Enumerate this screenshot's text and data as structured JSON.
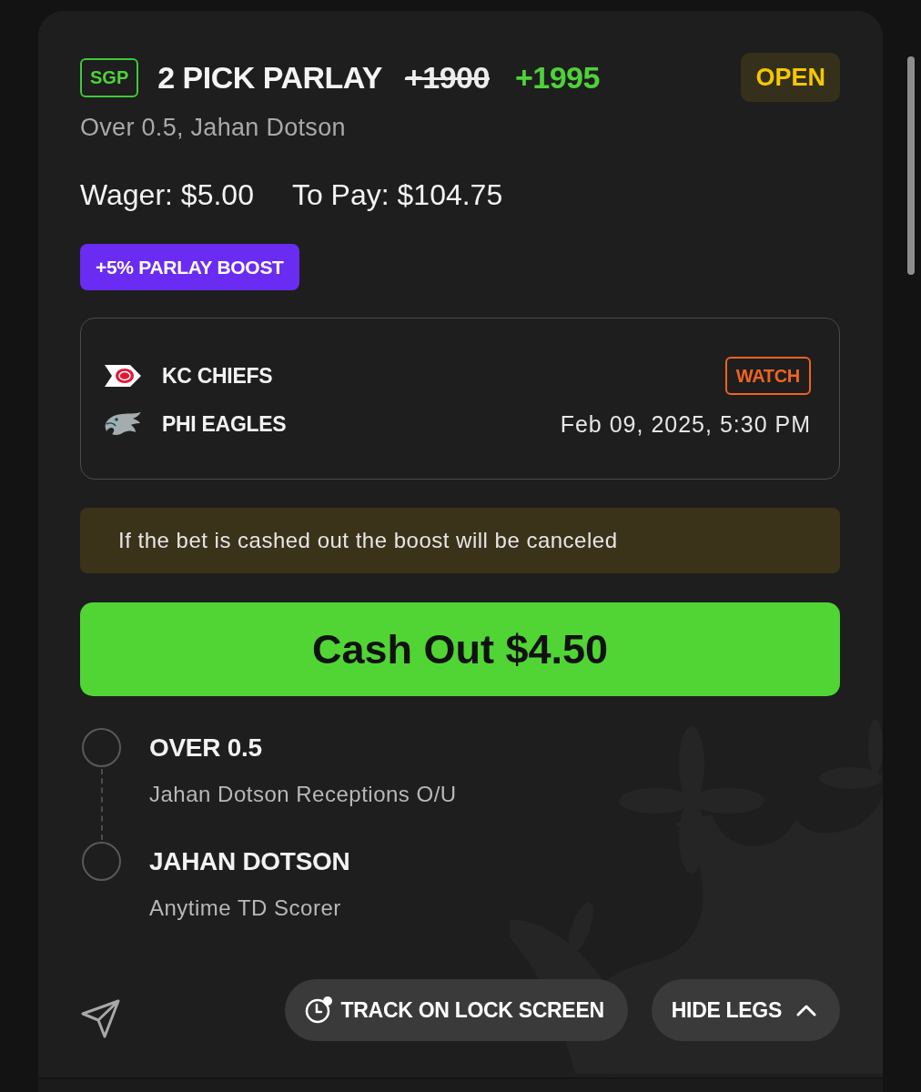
{
  "bet": {
    "tag": "SGP",
    "title": "2 PICK PARLAY",
    "original_odds": "+1900",
    "boosted_odds": "+1995",
    "status": {
      "label": "OPEN",
      "kind": "open"
    },
    "selections": "Over 0.5, Jahan Dotson",
    "wager": "Wager: $5.00",
    "to_pay": "To Pay: $104.75",
    "boost": "+5% PARLAY BOOST"
  },
  "game": {
    "teams": [
      {
        "name": "KC CHIEFS"
      },
      {
        "name": "PHI EAGLES"
      }
    ],
    "watch_button": "WATCH",
    "start_time": "Feb 09, 2025, 5:30 PM"
  },
  "notice": "If the bet is cashed out the boost will be canceled",
  "cash_out_button": "Cash Out $4.50",
  "legs": [
    {
      "pick": "OVER 0.5",
      "market": "Jahan Dotson Receptions O/U"
    },
    {
      "pick": "JAHAN DOTSON",
      "market": "Anytime TD Scorer"
    }
  ],
  "actions": [
    {
      "label": "TRACK ON LOCK SCREEN",
      "kind": "track"
    },
    {
      "label": "HIDE LEGS",
      "kind": "toggle",
      "expanded": true
    }
  ]
}
